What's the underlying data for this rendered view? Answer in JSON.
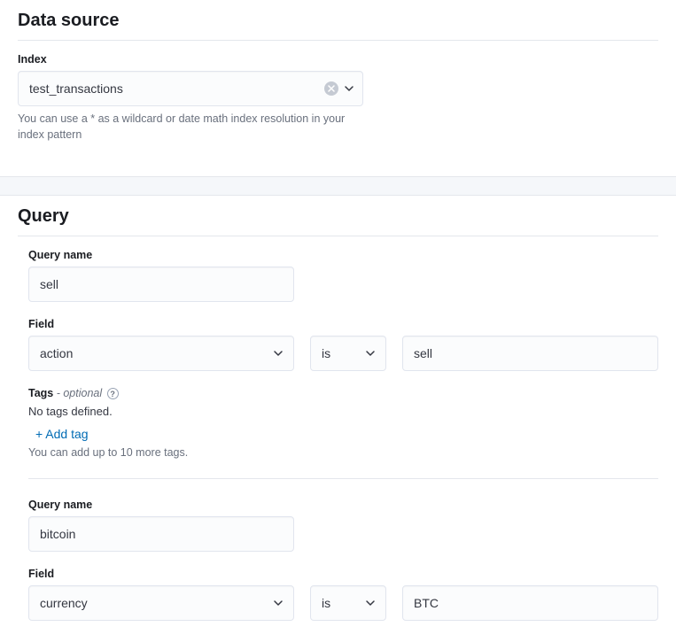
{
  "dataSource": {
    "title": "Data source",
    "indexLabel": "Index",
    "indexValue": "test_transactions",
    "indexHelp": "You can use a * as a wildcard or date math index resolution in your index pattern"
  },
  "querySection": {
    "title": "Query",
    "queryNameLabel": "Query name",
    "fieldLabel": "Field",
    "tagsLabel": "Tags",
    "tagsOptional": " - optional",
    "noTagsText": "No tags defined.",
    "addTagLabel": "+ Add tag",
    "tagsHelp": "You can add up to 10 more tags.",
    "queries": [
      {
        "name": "sell",
        "field": "action",
        "operator": "is",
        "value": "sell"
      },
      {
        "name": "bitcoin",
        "field": "currency",
        "operator": "is",
        "value": "BTC"
      }
    ]
  }
}
